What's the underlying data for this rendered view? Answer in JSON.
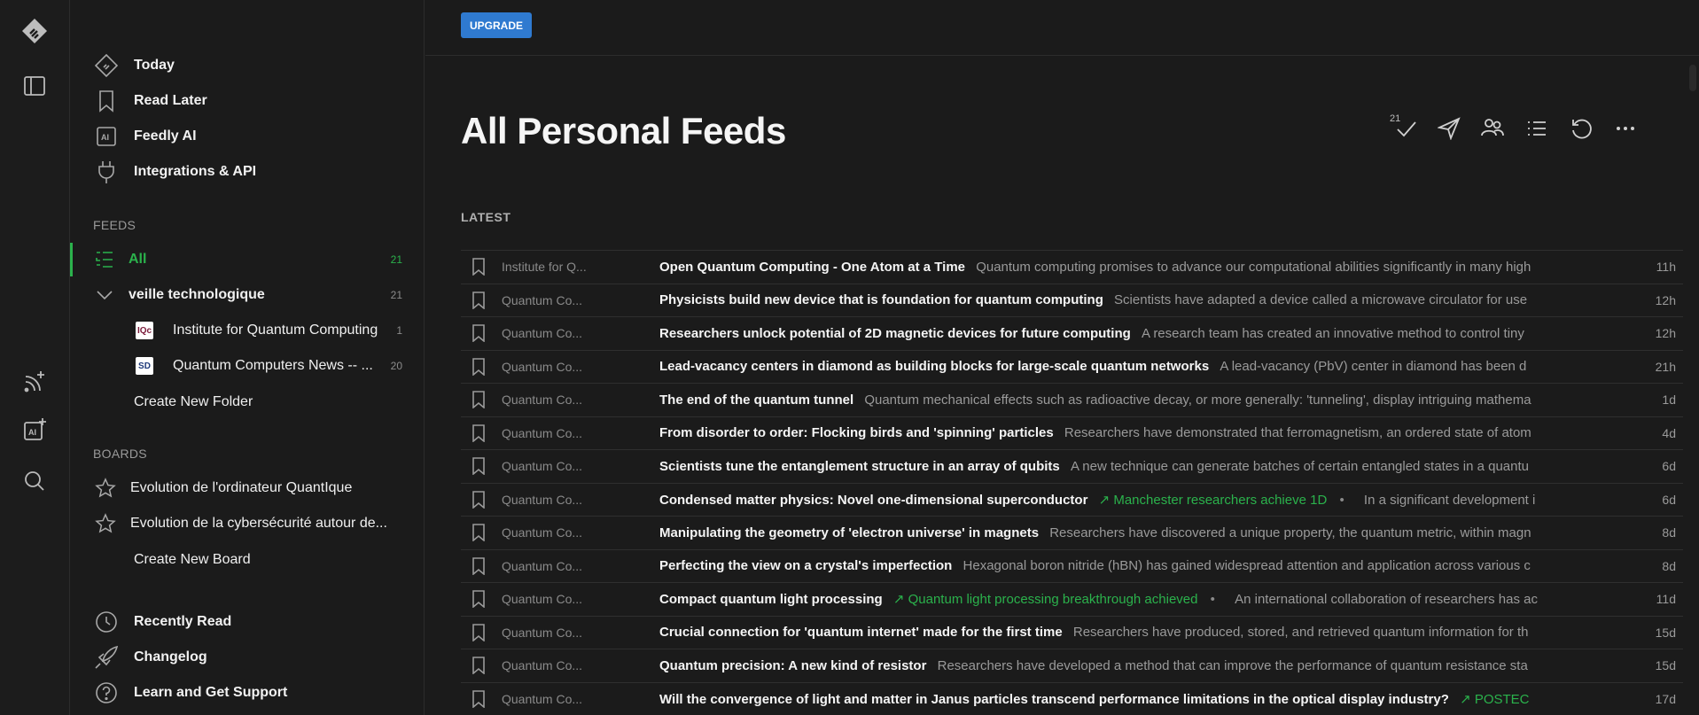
{
  "colors": {
    "accent_green": "#2bb24c",
    "upgrade_blue": "#2f7ad0",
    "background": "#1b1b1b"
  },
  "rail": {
    "icons": [
      "feedly-logo-icon",
      "sidebar-toggle-icon",
      "add-feed-icon",
      "add-ai-feed-icon",
      "search-icon"
    ]
  },
  "sidebar": {
    "nav": [
      {
        "label": "Today",
        "icon": "today-icon"
      },
      {
        "label": "Read Later",
        "icon": "bookmark-icon"
      },
      {
        "label": "Feedly AI",
        "icon": "ai-icon"
      },
      {
        "label": "Integrations & API",
        "icon": "plug-icon"
      }
    ],
    "feeds_title": "FEEDS",
    "feeds": {
      "all_label": "All",
      "all_count": "21",
      "folder_label": "veille technologique",
      "folder_count": "21",
      "sources": [
        {
          "label": "Institute for Quantum Computing",
          "count": "1",
          "favicon": "IQc"
        },
        {
          "label": "Quantum Computers News -- ...",
          "count": "20",
          "favicon": "SD"
        }
      ],
      "create_folder": "Create New Folder"
    },
    "boards_title": "BOARDS",
    "boards": [
      {
        "label": "Evolution de l'ordinateur QuantIque"
      },
      {
        "label": "Evolution de la cybersécurité autour de..."
      }
    ],
    "create_board": "Create New Board",
    "footer": [
      {
        "label": "Recently Read",
        "icon": "clock-icon"
      },
      {
        "label": "Changelog",
        "icon": "rocket-icon"
      },
      {
        "label": "Learn and Get Support",
        "icon": "help-icon"
      }
    ]
  },
  "main": {
    "upgrade_label": "UPGRADE",
    "title": "All Personal Feeds",
    "mark_read_count": "21",
    "section_label": "LATEST",
    "articles": [
      {
        "source": "Institute for Q...",
        "title": "Open Quantum Computing - One Atom at a Time",
        "summary": "Quantum computing promises to advance our computational abilities significantly in many high",
        "trend": "",
        "age": "11h"
      },
      {
        "source": "Quantum Co...",
        "title": "Physicists build new device that is foundation for quantum computing",
        "summary": "Scientists have adapted a device called a microwave circulator for use",
        "trend": "",
        "age": "12h"
      },
      {
        "source": "Quantum Co...",
        "title": "Researchers unlock potential of 2D magnetic devices for future computing",
        "summary": "A research team has created an innovative method to control tiny",
        "trend": "",
        "age": "12h"
      },
      {
        "source": "Quantum Co...",
        "title": "Lead-vacancy centers in diamond as building blocks for large-scale quantum networks",
        "summary": "A lead-vacancy (PbV) center in diamond has been d",
        "trend": "",
        "age": "21h"
      },
      {
        "source": "Quantum Co...",
        "title": "The end of the quantum tunnel",
        "summary": "Quantum mechanical effects such as radioactive decay, or more generally: 'tunneling', display intriguing mathema",
        "trend": "",
        "age": "1d"
      },
      {
        "source": "Quantum Co...",
        "title": "From disorder to order: Flocking birds and 'spinning' particles",
        "summary": "Researchers have demonstrated that ferromagnetism, an ordered state of atom",
        "trend": "",
        "age": "4d"
      },
      {
        "source": "Quantum Co...",
        "title": "Scientists tune the entanglement structure in an array of qubits",
        "summary": "A new technique can generate batches of certain entangled states in a quantu",
        "trend": "",
        "age": "6d"
      },
      {
        "source": "Quantum Co...",
        "title": "Condensed matter physics: Novel one-dimensional superconductor",
        "summary": "In a significant development i",
        "trend": "Manchester researchers achieve 1D",
        "age": "6d"
      },
      {
        "source": "Quantum Co...",
        "title": "Manipulating the geometry of 'electron universe' in magnets",
        "summary": "Researchers have discovered a unique property, the quantum metric, within magn",
        "trend": "",
        "age": "8d"
      },
      {
        "source": "Quantum Co...",
        "title": "Perfecting the view on a crystal's imperfection",
        "summary": "Hexagonal boron nitride (hBN) has gained widespread attention and application across various c",
        "trend": "",
        "age": "8d"
      },
      {
        "source": "Quantum Co...",
        "title": "Compact quantum light processing",
        "summary": "An international collaboration of researchers has ac",
        "trend": "Quantum light processing breakthrough achieved",
        "age": "11d"
      },
      {
        "source": "Quantum Co...",
        "title": "Crucial connection for 'quantum internet' made for the first time",
        "summary": "Researchers have produced, stored, and retrieved quantum information for th",
        "trend": "",
        "age": "15d"
      },
      {
        "source": "Quantum Co...",
        "title": "Quantum precision: A new kind of resistor",
        "summary": "Researchers have developed a method that can improve the performance of quantum resistance sta",
        "trend": "",
        "age": "15d"
      },
      {
        "source": "Quantum Co...",
        "title": "Will the convergence of light and matter in Janus particles transcend performance limitations in the optical display industry?",
        "summary": "",
        "trend": "POSTEC",
        "age": "17d"
      }
    ]
  }
}
